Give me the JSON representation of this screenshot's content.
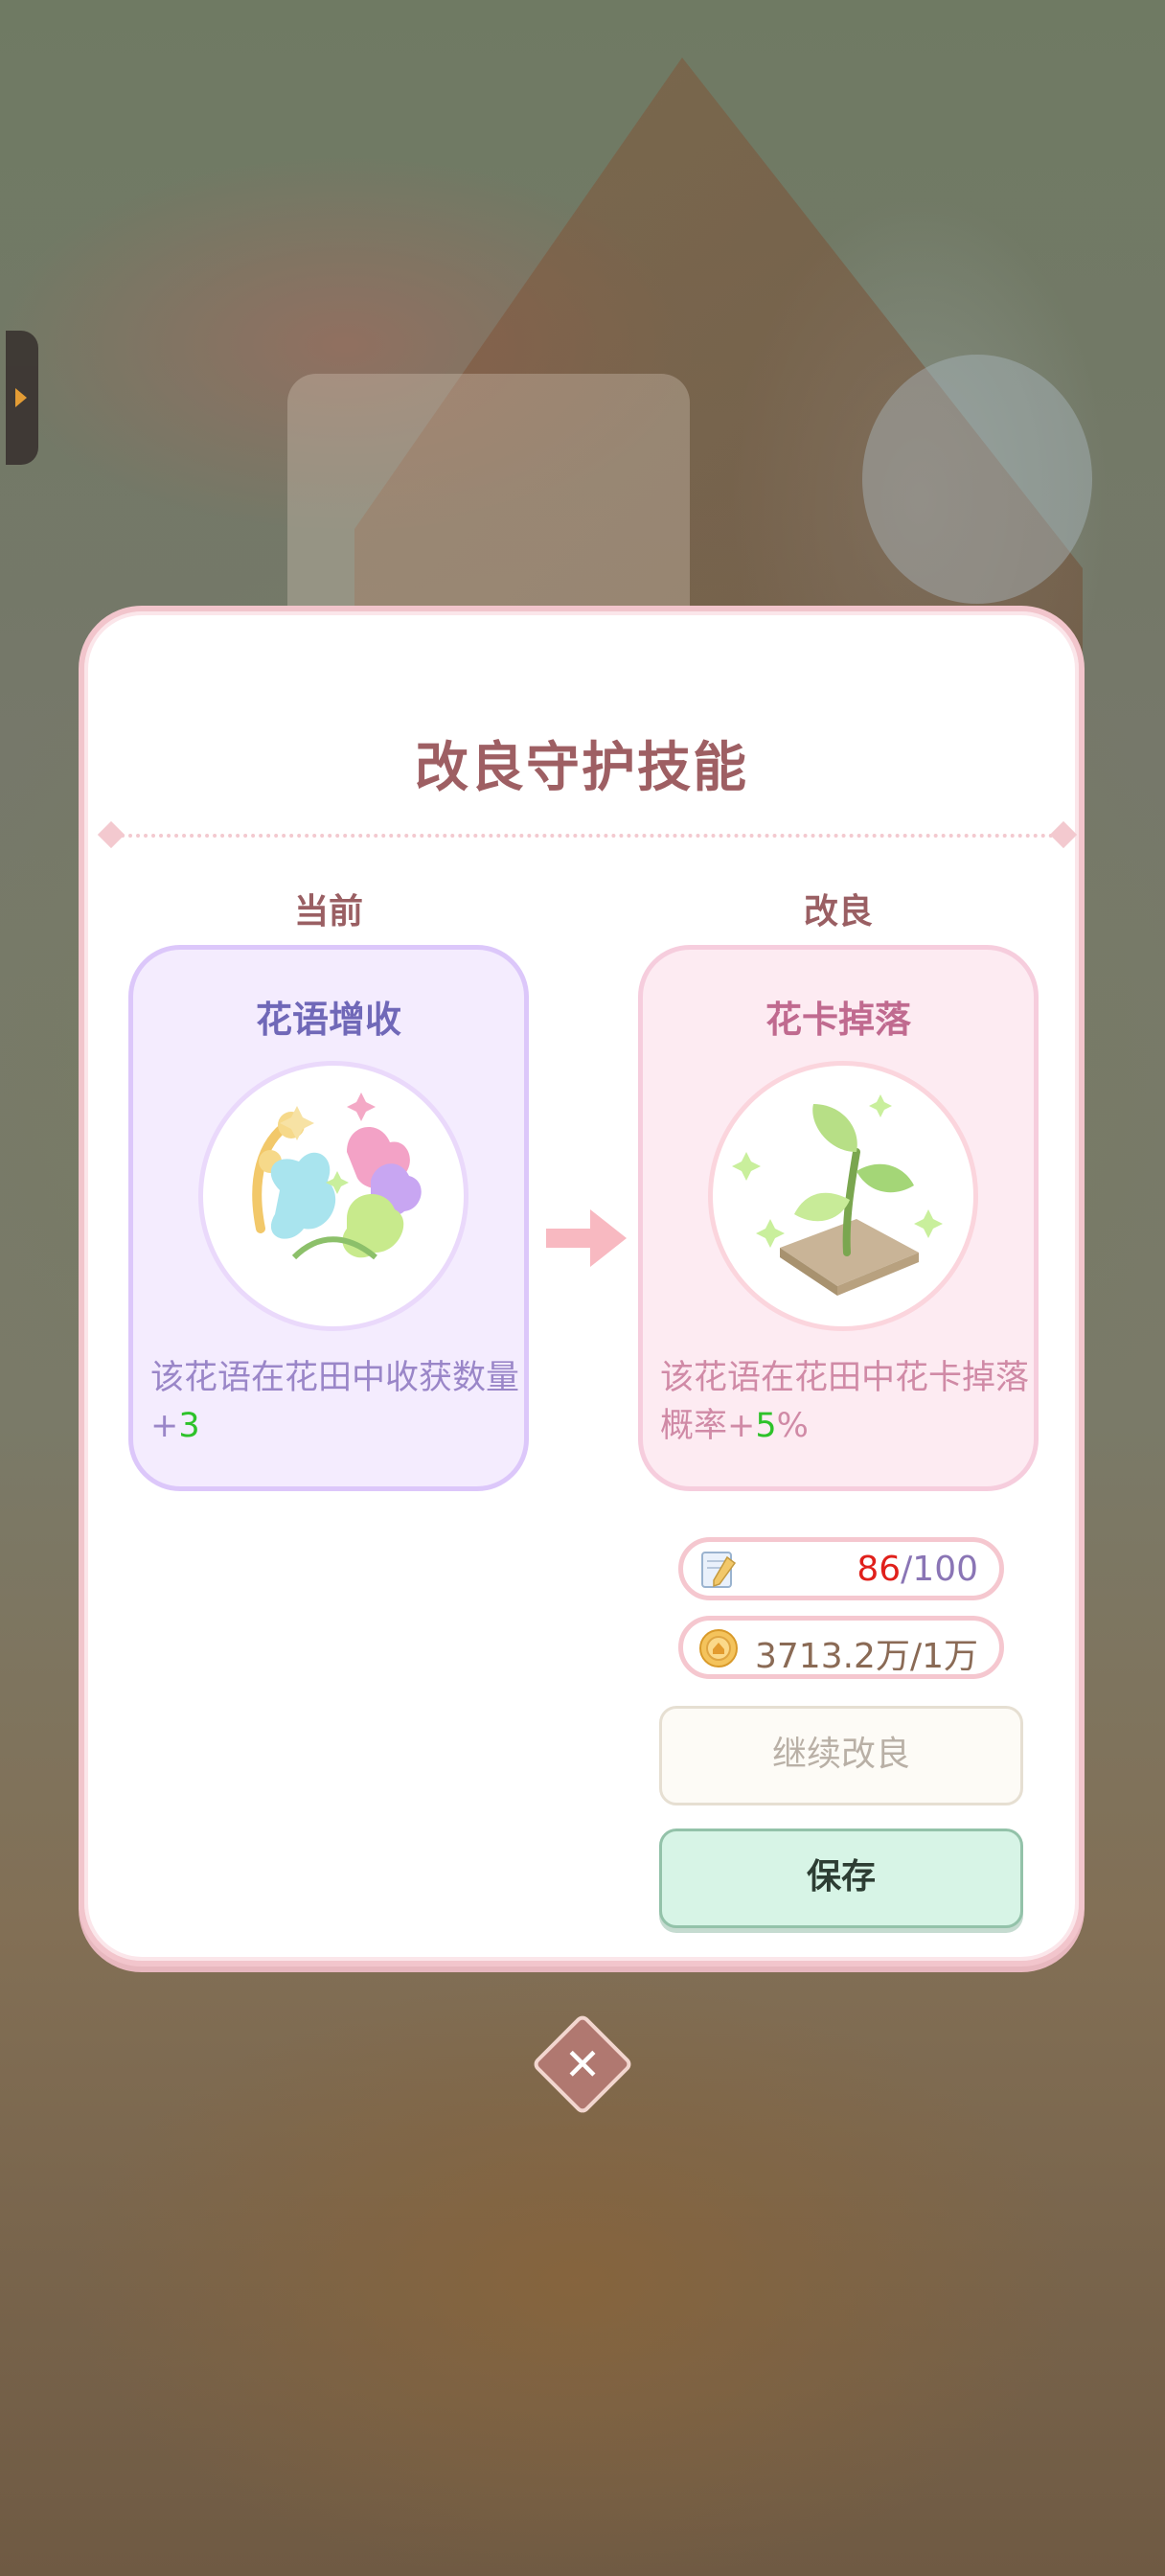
{
  "dialog": {
    "title": "改良守护技能",
    "current_label": "当前",
    "improved_label": "改良"
  },
  "current_skill": {
    "name": "花语增收",
    "desc_prefix": "该花语在花田中收获数量+",
    "desc_value": "3",
    "icon": "flower-bouquet-icon"
  },
  "improved_skill": {
    "name": "花卡掉落",
    "desc_prefix": "该花语在花田中花卡掉落概率+",
    "desc_value": "5",
    "desc_suffix": "%",
    "icon": "sprout-icon"
  },
  "resources": {
    "notes_current": "86",
    "notes_total": "/100",
    "notes_icon": "note-pen-icon",
    "coins_text": "3713.2万/1万",
    "coins_icon": "coin-icon"
  },
  "buttons": {
    "continue_label": "继续改良",
    "save_label": "保存",
    "close_icon": "close-icon"
  },
  "colors": {
    "accent_green": "#2ec22a",
    "title": "#9e5f63",
    "save_bg": "#d7f4e6"
  }
}
